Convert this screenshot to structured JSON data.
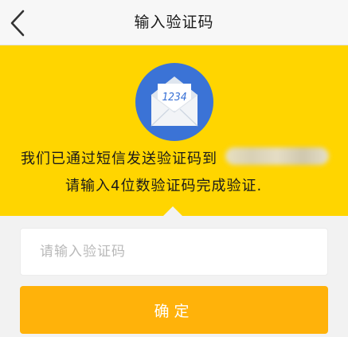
{
  "nav": {
    "title": "输入验证码"
  },
  "banner": {
    "envelope_code": "1234",
    "message_line1": "我们已通过短信发送验证码到",
    "message_line2": "请输入4位数验证码完成验证."
  },
  "form": {
    "code_placeholder": "请输入验证码",
    "code_value": "",
    "confirm_label": "确定"
  },
  "colors": {
    "banner_bg": "#ffd500",
    "envelope_circle": "#3b73d6",
    "confirm_button": "#ffb20a",
    "page_bg": "#f2f2f2"
  }
}
